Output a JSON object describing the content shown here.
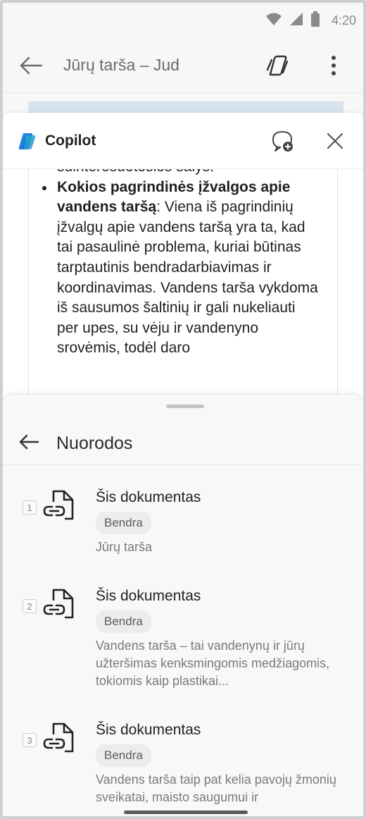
{
  "status_bar": {
    "time": "4:20"
  },
  "app_bar": {
    "title": "Jūrų tarša – Jud"
  },
  "copilot": {
    "name": "Copilot",
    "partial_line": "suinteresuotosios šalys.",
    "bullet_heading": "Kokios pagrindinės įžvalgos apie vandens taršą",
    "bullet_text": ": Viena iš pagrindinių įžvalgų apie vandens taršą yra ta, kad tai pasaulinė problema, kuriai būtinas tarptautinis bendradarbiavimas ir koordinavimas. Vandens tarša vykdoma iš sausumos šaltinių ir gali nukeliauti per upes, su vėju ir vandenyno srovėmis, todėl daro"
  },
  "sheet": {
    "title": "Nuorodos",
    "references": [
      {
        "num": "1",
        "title": "Šis dokumentas",
        "badge": "Bendra",
        "snippet": "Jūrų tarša"
      },
      {
        "num": "2",
        "title": "Šis dokumentas",
        "badge": "Bendra",
        "snippet": "Vandens tarša – tai vandenynų ir jūrų užteršimas kenksmingomis medžiagomis, tokiomis kaip plastikai..."
      },
      {
        "num": "3",
        "title": "Šis dokumentas",
        "badge": "Bendra",
        "snippet": "Vandens tarša taip pat kelia pavojų žmonių sveikatai, maisto saugumui ir"
      }
    ]
  },
  "icons": {
    "wifi": "wifi-icon",
    "signal": "signal-icon",
    "battery": "battery-icon",
    "back": "back-arrow-icon",
    "copilot_app": "copilot-app-icon",
    "more": "more-vertical-icon",
    "copilot_logo": "copilot-logo-icon",
    "new_chat": "new-chat-icon",
    "close": "close-icon",
    "document_link": "document-link-icon"
  },
  "colors": {
    "accent_doc_strip": "#d6e3ee",
    "badge_bg": "#ececec"
  }
}
